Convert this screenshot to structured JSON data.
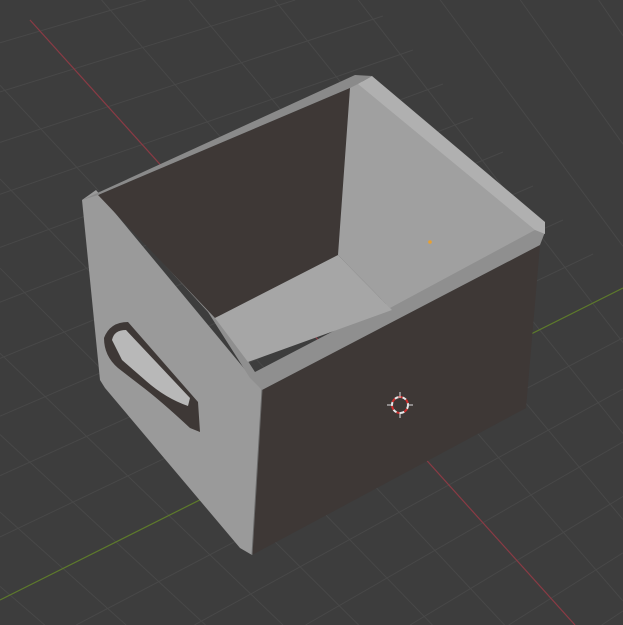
{
  "viewport": {
    "mode": "3d-viewport",
    "colors": {
      "background": "#3d3d3d",
      "grid": "#484848",
      "x_axis": "#8a3a44",
      "y_axis": "#5d7a2a",
      "light_face": "#9a9a9a",
      "mid_face": "#8c8c8c",
      "dark_face": "#3e3836",
      "origin": "#e8a030"
    },
    "objects": [
      {
        "name": "box",
        "type": "mesh"
      }
    ]
  }
}
